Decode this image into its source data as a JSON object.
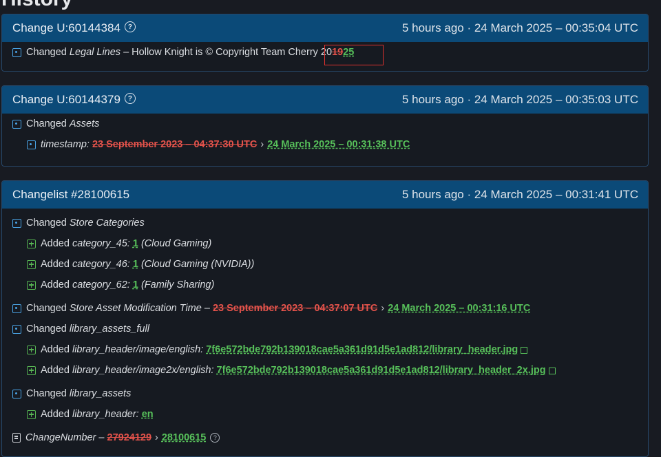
{
  "page": {
    "heading": "History"
  },
  "cards": [
    {
      "title": "Change U:60144384",
      "time": "5 hours ago · 24 March 2025 – 00:35:04 UTC",
      "rows": [
        {
          "prefix": "Changed ",
          "key": "Legal Lines",
          "text": " – Hollow Knight is © Copyright Team Cherry 20",
          "old": "19",
          "new": "25"
        }
      ]
    },
    {
      "title": "Change U:60144379",
      "time": "5 hours ago · 24 March 2025 – 00:35:03 UTC",
      "rows": [
        {
          "prefix": "Changed ",
          "key": "Assets"
        },
        {
          "key": "timestamp",
          "sep": ": ",
          "old": "23 September 2023 – 04:37:30 UTC",
          "arrow": "›",
          "new": "24 March 2025 – 00:31:38 UTC"
        }
      ]
    },
    {
      "title": "Changelist #28100615",
      "time": "5 hours ago · 24 March 2025 – 00:31:41 UTC",
      "rows": [
        {
          "prefix": "Changed ",
          "key": "Store Categories"
        },
        {
          "prefix": "Added ",
          "key": "category_45",
          "sep": ": ",
          "new": "1",
          "note": " (Cloud Gaming)"
        },
        {
          "prefix": "Added ",
          "key": "category_46",
          "sep": ": ",
          "new": "1",
          "note": " (Cloud Gaming (NVIDIA))"
        },
        {
          "prefix": "Added ",
          "key": "category_62",
          "sep": ": ",
          "new": "1",
          "note": " (Family Sharing)"
        },
        {
          "prefix": "Changed ",
          "key": "Store Asset Modification Time",
          "sep": " – ",
          "old": "23 September 2023 – 04:37:07 UTC",
          "arrow": "›",
          "new": "24 March 2025 – 00:31:16 UTC"
        },
        {
          "prefix": "Changed ",
          "key": "library_assets_full"
        },
        {
          "prefix": "Added ",
          "key": "library_header/image/english",
          "sep": ": ",
          "new": "7f6e572bde792b139018cae5a361d91d5e1ad812/library_header.jpg"
        },
        {
          "prefix": "Added ",
          "key": "library_header/image2x/english",
          "sep": ": ",
          "new": "7f6e572bde792b139018cae5a361d91d5e1ad812/library_header_2x.jpg"
        },
        {
          "prefix": "Changed ",
          "key": "library_assets"
        },
        {
          "prefix": "Added ",
          "key": "library_header",
          "sep": ": ",
          "new": "en"
        },
        {
          "key": "ChangeNumber",
          "sep": " – ",
          "old": "27924129",
          "arrow": "›",
          "new": "28100615"
        }
      ]
    }
  ]
}
